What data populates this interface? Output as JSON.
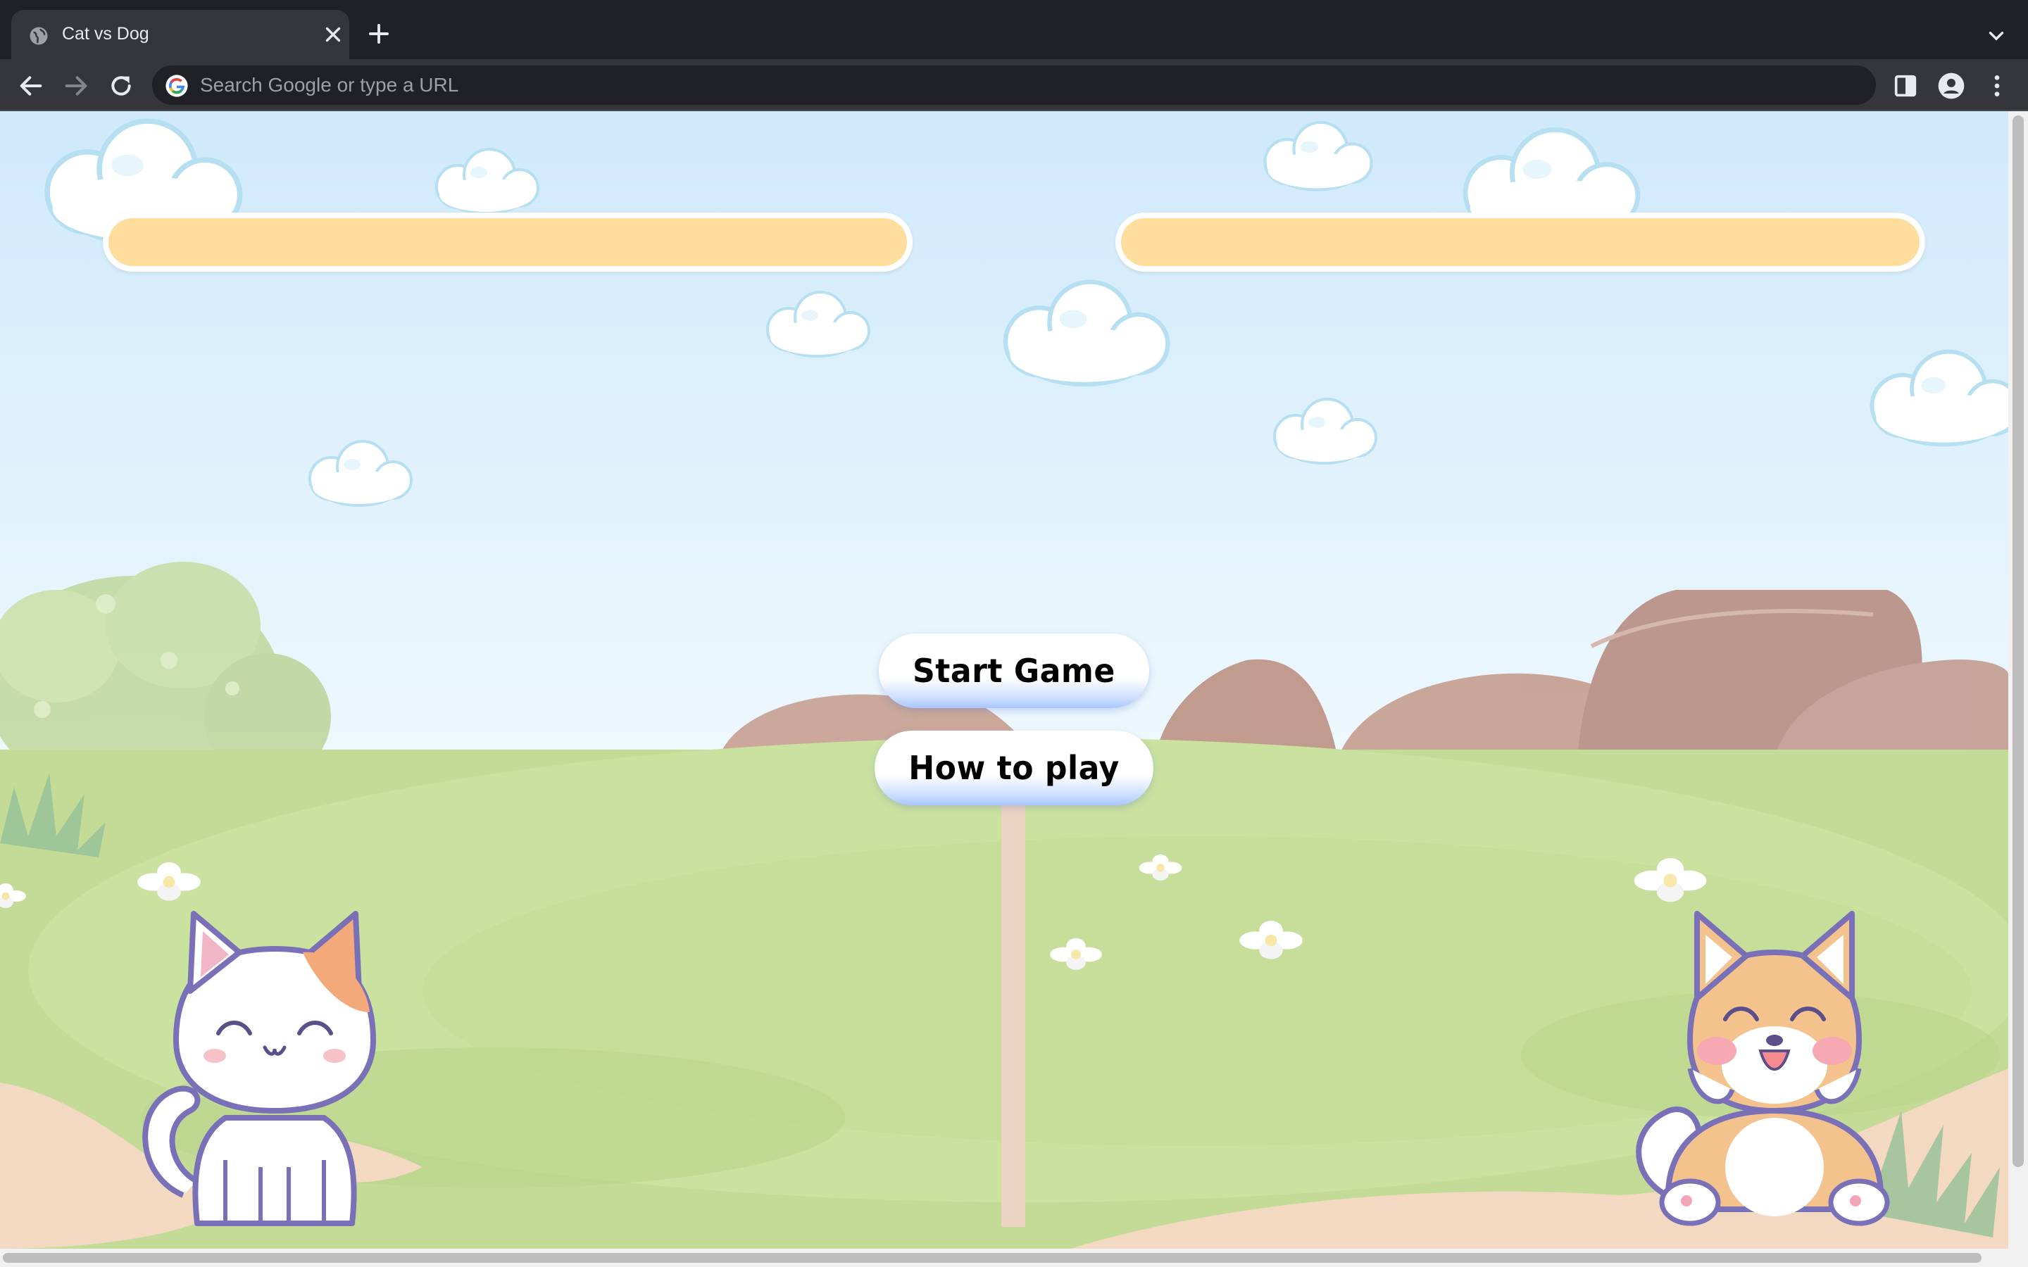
{
  "browser": {
    "tab_title": "Cat vs Dog",
    "omnibox_placeholder": "Search Google or type a URL"
  },
  "game": {
    "menu": {
      "start_label": "Start Game",
      "howto_label": "How to play"
    },
    "health": {
      "cat_fraction": 1.0,
      "dog_fraction": 1.0
    }
  },
  "colors": {
    "sky_top": "#cfe9fb",
    "sky_bottom": "#eaf6fd",
    "grass": "#c6dd98",
    "health_fill": "#ffdd9c",
    "button_glow": "#a9c6ff"
  }
}
